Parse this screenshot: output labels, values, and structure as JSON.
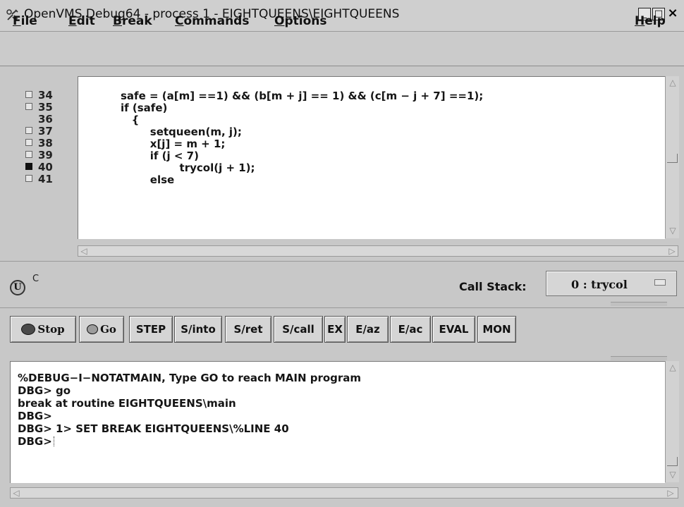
{
  "window": {
    "title": "OpenVMS Debug64 - process 1 - EIGHTQUEENS\\EIGHTQUEENS",
    "minimize_label": "_",
    "maximize_label": "□",
    "close_label": "×"
  },
  "menubar": {
    "file": {
      "mnemonic": "F",
      "rest": "ile"
    },
    "edit": {
      "mnemonic": "E",
      "rest": "dit"
    },
    "break": {
      "mnemonic": "B",
      "rest": "reak"
    },
    "commands": {
      "mnemonic": "C",
      "rest": "ommands"
    },
    "options": {
      "mnemonic": "O",
      "rest": "ptions"
    },
    "help": {
      "mnemonic": "H",
      "rest": "elp"
    }
  },
  "source": {
    "lines": [
      {
        "num": "34",
        "breakpoint": "empty",
        "code": "safe = (a[m] ==1) && (b[m + j] == 1) && (c[m − j + 7] ==1);"
      },
      {
        "num": "35",
        "breakpoint": "empty",
        "code": "if (safe)"
      },
      {
        "num": "36",
        "breakpoint": "none",
        "code": "   {"
      },
      {
        "num": "37",
        "breakpoint": "empty",
        "code": "        setqueen(m, j);"
      },
      {
        "num": "38",
        "breakpoint": "empty",
        "code": "        x[j] = m + 1;"
      },
      {
        "num": "39",
        "breakpoint": "empty",
        "code": "        if (j < 7)"
      },
      {
        "num": "40",
        "breakpoint": "set",
        "code": "                trycol(j + 1);"
      },
      {
        "num": "41",
        "breakpoint": "empty",
        "code": "        else"
      }
    ]
  },
  "status": {
    "u_label": "U",
    "c_flag": "C",
    "callstack_label": "Call Stack:",
    "callstack_value": "0 : trycol"
  },
  "buttons": {
    "stop": "Stop",
    "go": "Go",
    "step": "STEP",
    "s_into": "S/into",
    "s_ret": "S/ret",
    "s_call": "S/call",
    "ex": "EX",
    "e_az": "E/az",
    "e_ac": "E/ac",
    "eval": "EVAL",
    "mon": "MON"
  },
  "console": {
    "lines": [
      "%DEBUG−I−NOTATMAIN, Type GO to reach MAIN program",
      "DBG> go",
      "break at routine EIGHTQUEENS\\main",
      "DBG>",
      "DBG> 1> SET BREAK EIGHTQUEENS\\%LINE 40",
      "DBG>"
    ]
  }
}
